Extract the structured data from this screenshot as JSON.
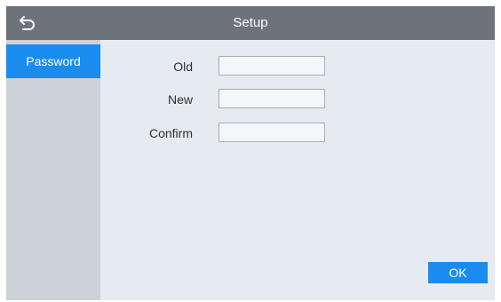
{
  "header": {
    "title": "Setup",
    "back_icon": "back-arrow-icon"
  },
  "sidebar": {
    "items": [
      {
        "label": "Password",
        "selected": true
      }
    ]
  },
  "form": {
    "old": {
      "label": "Old",
      "value": ""
    },
    "new": {
      "label": "New",
      "value": ""
    },
    "confirm": {
      "label": "Confirm",
      "value": ""
    }
  },
  "actions": {
    "ok_label": "OK"
  },
  "colors": {
    "title_bar": "#6e7279",
    "accent": "#1a8cf0",
    "sidebar": "#cdd1d8",
    "content": "#e6eaf1"
  }
}
